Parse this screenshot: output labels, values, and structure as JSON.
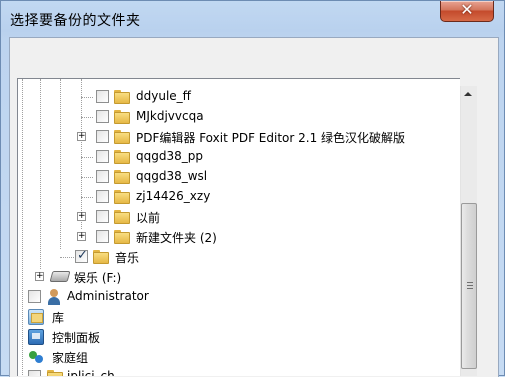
{
  "window": {
    "title": "选择要备份的文件夹",
    "close_label": "✕"
  },
  "tree": {
    "items": [
      {
        "label": "ddyule_ff",
        "checked": false
      },
      {
        "label": "MJkdjvvcqa",
        "checked": false
      },
      {
        "label": "PDF编辑器  Foxit PDF Editor 2.1 绿色汉化破解版",
        "checked": false
      },
      {
        "label": "qqgd38_pp",
        "checked": false
      },
      {
        "label": "qqgd38_wsl",
        "checked": false
      },
      {
        "label": "zj14426_xzy",
        "checked": false
      },
      {
        "label": "以前",
        "checked": false
      },
      {
        "label": "新建文件夹 (2)",
        "checked": false
      },
      {
        "label": "音乐",
        "checked": true
      },
      {
        "label": "娱乐 (F:)"
      },
      {
        "label": "Administrator",
        "checked": false
      },
      {
        "label": "库"
      },
      {
        "label": "控制面板"
      },
      {
        "label": "家庭组"
      },
      {
        "label": "ipljcj_ch",
        "checked": false
      }
    ]
  },
  "icons": {
    "folder": "folder-icon",
    "drive": "drive-icon",
    "user": "user-icon",
    "library": "library-icon",
    "control_panel": "control-panel-icon",
    "homegroup": "homegroup-icon"
  }
}
